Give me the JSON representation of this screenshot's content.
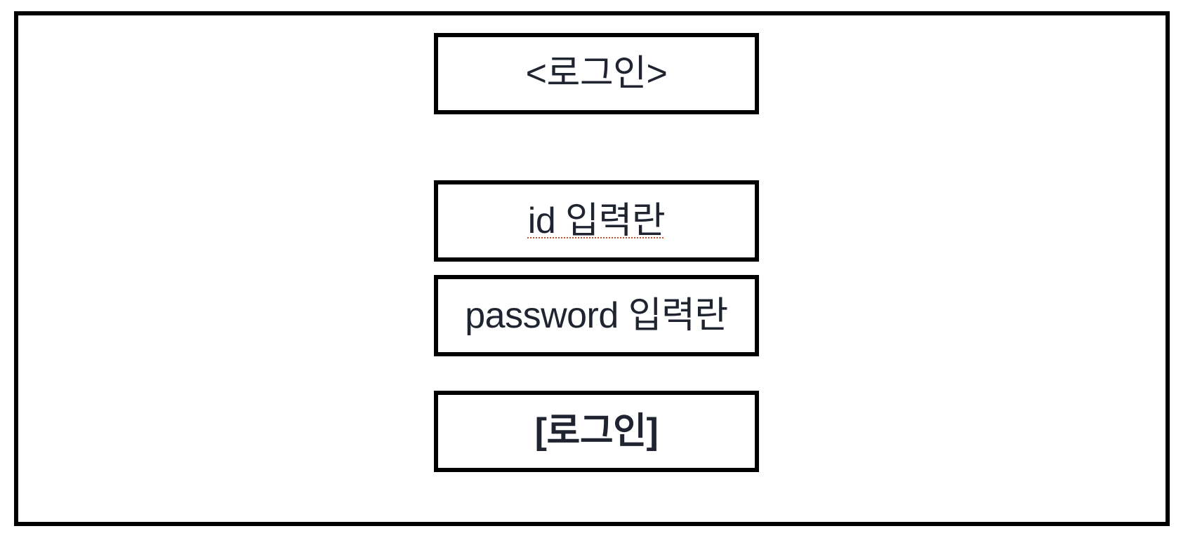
{
  "screen": {
    "title": "<로그인>",
    "id_field_label": "id 입력란",
    "password_field_label": "password 입력란",
    "login_button_label": "[로그인]"
  }
}
